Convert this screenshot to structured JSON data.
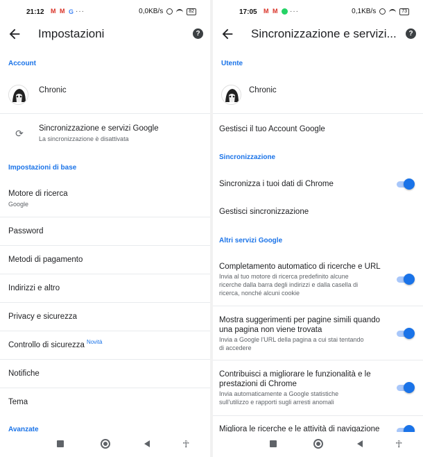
{
  "left": {
    "status": {
      "time": "21:12",
      "speed": "0,0KB/s",
      "battery": "82",
      "notif_icons": [
        "gmail-icon",
        "gmail-icon",
        "google-icon"
      ]
    },
    "appbar": {
      "title": "Impostazioni"
    },
    "sections": {
      "account": "Account",
      "base": "Impostazioni di base",
      "advanced": "Avanzate"
    },
    "account": {
      "name": "Chronic"
    },
    "sync": {
      "title": "Sincronizzazione e servizi Google",
      "subtitle": "La sincronizzazione è disattivata"
    },
    "search_engine": {
      "title": "Motore di ricerca",
      "value": "Google"
    },
    "items": {
      "password": "Password",
      "payment": "Metodi di pagamento",
      "addresses": "Indirizzi e altro",
      "privacy": "Privacy e sicurezza",
      "safety_check": "Controllo di sicurezza",
      "safety_badge": "Novità",
      "notifications": "Notifiche",
      "theme": "Tema"
    }
  },
  "right": {
    "status": {
      "time": "17:05",
      "speed": "0,1KB/s",
      "battery": "73",
      "notif_icons": [
        "gmail-icon",
        "gmail-icon",
        "whatsapp-icon"
      ]
    },
    "appbar": {
      "title": "Sincronizzazione e servizi..."
    },
    "sections": {
      "user": "Utente",
      "sync": "Sincronizzazione",
      "other": "Altri servizi Google"
    },
    "account": {
      "name": "Chronic"
    },
    "manage_account": "Gestisci il tuo Account Google",
    "sync_chrome": {
      "title": "Sincronizza i tuoi dati di Chrome",
      "enabled": true
    },
    "manage_sync": "Gestisci sincronizzazione",
    "autocomplete": {
      "title": "Completamento automatico di ricerche e URL",
      "desc_1": "Invia al tuo motore di ricerca predefinito alcune",
      "desc_2": "ricerche dalla barra degli indirizzi e dalla casella di",
      "desc_3": "ricerca, nonché alcuni cookie",
      "enabled": true
    },
    "similar_pages": {
      "title_1": "Mostra suggerimenti per pagine simili quando",
      "title_2": "una pagina non viene trovata",
      "desc_1": "Invia a Google l'URL della pagina a cui stai tentando",
      "desc_2": "di accedere",
      "enabled": true
    },
    "improve": {
      "title_1": "Contribuisci a migliorare le funzionalità e le",
      "title_2": "prestazioni di Chrome",
      "desc_1": "Invia automaticamente a Google statistiche",
      "desc_2": "sull'utilizzo e rapporti sugli arresti anomali",
      "enabled": true
    },
    "better_search": {
      "title": "Migliora le ricerche e le attività di navigazione",
      "enabled": true
    }
  },
  "colors": {
    "accent": "#1a73e8",
    "toggle_track": "#a8c7fa",
    "text": "#202124",
    "secondary": "#5f6368"
  }
}
